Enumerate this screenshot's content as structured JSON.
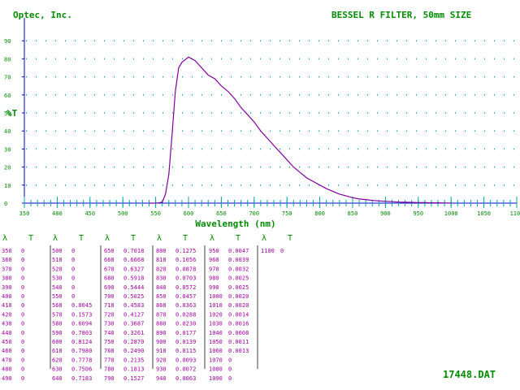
{
  "header": {
    "company": "Optec, Inc.",
    "title": "BESSEL R FILTER, 50mm SIZE"
  },
  "footer": {
    "filename": "17448.DAT"
  },
  "colors": {
    "text_green": "#008c00",
    "axis_blue": "#0000cc",
    "tick_cyan": "#00a8a8",
    "curve": "#8000a0",
    "table_data": "#a000a0",
    "table_sep": "#404040"
  },
  "chart_data": {
    "type": "line",
    "title": "",
    "xlabel": "Wavelength (nm)",
    "ylabel": "%T",
    "xlim": [
      350,
      1100
    ],
    "ylim": [
      0,
      100
    ],
    "xticks": [
      350,
      400,
      450,
      500,
      550,
      600,
      650,
      700,
      750,
      800,
      850,
      900,
      950,
      1000,
      1050,
      1100
    ],
    "yticks": [
      0,
      10,
      20,
      30,
      40,
      50,
      60,
      70,
      80,
      90
    ],
    "grid": "dotted horizontal",
    "series": [
      {
        "x": [
          540,
          550,
          555,
          560,
          565,
          570,
          575,
          580,
          585,
          590,
          600,
          610,
          620,
          630,
          640,
          650,
          660,
          670,
          680,
          690,
          700,
          710,
          720,
          730,
          740,
          750,
          760,
          770,
          780,
          790,
          800,
          810,
          820,
          830,
          840,
          850,
          860,
          870,
          880,
          890,
          900,
          910,
          920,
          930,
          940,
          950,
          960,
          970,
          980,
          990,
          1000
        ],
        "y": [
          0,
          0,
          0.2,
          0.5,
          5,
          16,
          38,
          62,
          75,
          78,
          81,
          79,
          75,
          71,
          69,
          65,
          62,
          58,
          53,
          49,
          45,
          40,
          36,
          32,
          28,
          24,
          20,
          17,
          14,
          12,
          10,
          8,
          6.5,
          5,
          4,
          3,
          2.3,
          2,
          1.5,
          1.2,
          1,
          0.8,
          0.6,
          0.5,
          0.4,
          0.3,
          0.3,
          0.2,
          0.2,
          0.1,
          0.1
        ]
      }
    ]
  },
  "table": {
    "headers": {
      "lambda": "λ",
      "t": "T"
    },
    "columns": [
      {
        "lambda": [
          "350",
          "360",
          "370",
          "380",
          "390",
          "400",
          "410",
          "420",
          "430",
          "440",
          "450",
          "460",
          "470",
          "480",
          "490"
        ],
        "t": [
          "0",
          "0",
          "0",
          "0",
          "0",
          "0",
          "0",
          "0",
          "0",
          "0",
          "0",
          "0",
          "0",
          "0",
          "0"
        ]
      },
      {
        "lambda": [
          "500",
          "510",
          "520",
          "530",
          "540",
          "550",
          "560",
          "570",
          "580",
          "590",
          "600",
          "610",
          "620",
          "630",
          "640"
        ],
        "t": [
          "0",
          "0",
          "0",
          "0",
          "0",
          "0",
          "0.0045",
          "0.1573",
          "0.6094",
          "0.7803",
          "0.8124",
          "0.7980",
          "0.7778",
          "0.7506",
          "0.7183"
        ]
      },
      {
        "lambda": [
          "650",
          "660",
          "670",
          "680",
          "690",
          "700",
          "710",
          "720",
          "730",
          "740",
          "750",
          "760",
          "770",
          "780",
          "790"
        ],
        "t": [
          "0.7018",
          "0.6668",
          "0.6327",
          "0.5918",
          "0.5444",
          "0.5025",
          "0.4583",
          "0.4127",
          "0.3687",
          "0.3261",
          "0.2870",
          "0.2490",
          "0.2135",
          "0.1813",
          "0.1527"
        ]
      },
      {
        "lambda": [
          "800",
          "810",
          "820",
          "830",
          "840",
          "850",
          "860",
          "870",
          "880",
          "890",
          "900",
          "910",
          "920",
          "930",
          "940"
        ],
        "t": [
          "0.1275",
          "0.1056",
          "0.0878",
          "0.0703",
          "0.0572",
          "0.0457",
          "0.0363",
          "0.0288",
          "0.0230",
          "0.0177",
          "0.0139",
          "0.0115",
          "0.0093",
          "0.0072",
          "0.0063"
        ]
      },
      {
        "lambda": [
          "950",
          "960",
          "970",
          "980",
          "990",
          "1000",
          "1010",
          "1020",
          "1030",
          "1040",
          "1050",
          "1060",
          "1070",
          "1080",
          "1090"
        ],
        "t": [
          "0.0047",
          "0.0039",
          "0.0032",
          "0.0025",
          "0.0025",
          "0.0020",
          "0.0020",
          "0.0014",
          "0.0016",
          "0.0008",
          "0.0011",
          "0.0013",
          "0",
          "0",
          "0"
        ]
      },
      {
        "lambda": [
          "1100"
        ],
        "t": [
          "0"
        ]
      }
    ]
  }
}
